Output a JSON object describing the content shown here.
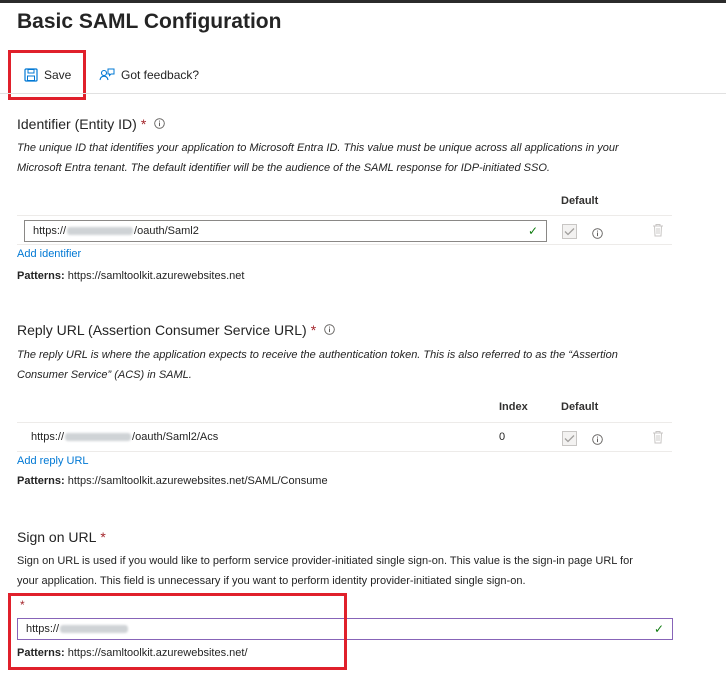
{
  "header": {
    "title": "Basic SAML Configuration"
  },
  "toolbar": {
    "save_label": "Save",
    "feedback_label": "Got feedback?"
  },
  "identifier": {
    "title": "Identifier (Entity ID)",
    "required_mark": "*",
    "description": "The unique ID that identifies your application to Microsoft Entra ID. This value must be unique across all applications in your Microsoft Entra tenant. The default identifier will be the audience of the SAML response for IDP-initiated SSO.",
    "column_default": "Default",
    "value_prefix": "https://",
    "value_suffix": "/oauth/Saml2",
    "add_link": "Add identifier",
    "patterns_label": "Patterns:",
    "patterns_value": "https://samltoolkit.azurewebsites.net"
  },
  "reply_url": {
    "title": "Reply URL (Assertion Consumer Service URL)",
    "required_mark": "*",
    "description": "The reply URL is where the application expects to receive the authentication token. This is also referred to as the “Assertion Consumer Service” (ACS) in SAML.",
    "column_index": "Index",
    "column_default": "Default",
    "value_prefix": "https://",
    "value_suffix": "/oauth/Saml2/Acs",
    "index_value": "0",
    "add_link": "Add reply URL",
    "patterns_label": "Patterns:",
    "patterns_value": "https://samltoolkit.azurewebsites.net/SAML/Consume"
  },
  "sign_on": {
    "title": "Sign on URL",
    "required_mark": "*",
    "description": "Sign on URL is used if you would like to perform service provider-initiated single sign-on. This value is the sign-in page URL for your application. This field is unnecessary if you want to perform identity provider-initiated single sign-on.",
    "field_required_mark": "*",
    "value_prefix": "https://",
    "patterns_label": "Patterns:",
    "patterns_value": "https://samltoolkit.azurewebsites.net/"
  },
  "colors": {
    "highlight": "#e0202b",
    "link": "#0078d4",
    "required": "#a4262c",
    "valid": "#107c10",
    "focus_border": "#8764b8"
  }
}
